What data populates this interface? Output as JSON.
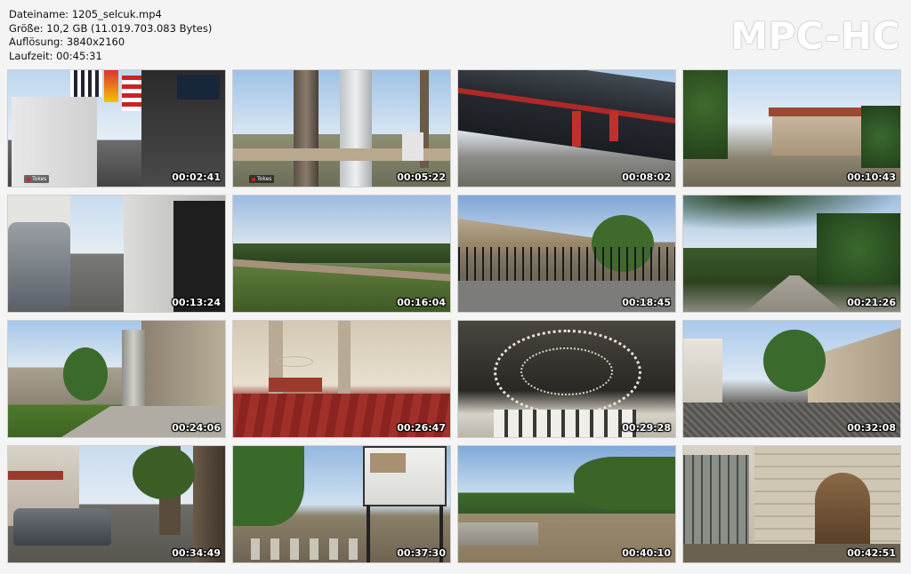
{
  "file_info": {
    "name_line": "Dateiname: 1205_selcuk.mp4",
    "size_line": "Größe: 10,2 GB (11.019.703.083 Bytes)",
    "resolution_line": "Auflösung: 3840x2160",
    "duration_line": "Laufzeit: 00:45:31"
  },
  "brand": "MPC-HC",
  "thumbnails": [
    {
      "time": "00:02:41",
      "badge": "Tokes"
    },
    {
      "time": "00:05:22",
      "badge": "Tokes"
    },
    {
      "time": "00:08:02"
    },
    {
      "time": "00:10:43"
    },
    {
      "time": "00:13:24"
    },
    {
      "time": "00:16:04"
    },
    {
      "time": "00:18:45"
    },
    {
      "time": "00:21:26"
    },
    {
      "time": "00:24:06"
    },
    {
      "time": "00:26:47"
    },
    {
      "time": "00:29:28"
    },
    {
      "time": "00:32:08"
    },
    {
      "time": "00:34:49"
    },
    {
      "time": "00:37:30"
    },
    {
      "time": "00:40:10"
    },
    {
      "time": "00:42:51"
    }
  ]
}
